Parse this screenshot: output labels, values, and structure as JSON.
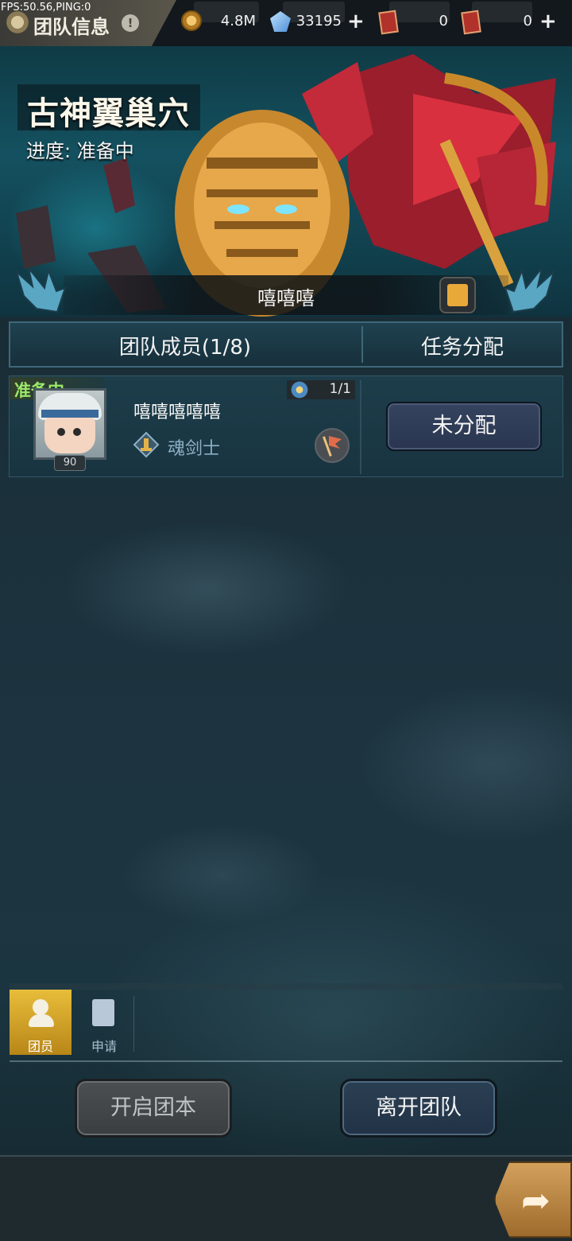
{
  "debug": {
    "fps_text": "FPS:50.56,PING:0"
  },
  "header": {
    "title": "团队信息",
    "info_glyph": "!",
    "currencies": [
      {
        "icon": "gold-coin-icon",
        "value": "4.8M",
        "has_plus": false
      },
      {
        "icon": "crystal-icon",
        "value": "33195",
        "has_plus": true
      },
      {
        "icon": "ticket-icon",
        "value": "0",
        "has_plus": false
      },
      {
        "icon": "ticket-icon",
        "value": "0",
        "has_plus": true
      }
    ],
    "plus_glyph": "+"
  },
  "banner": {
    "dungeon_name": "古神翼巢穴",
    "progress": "进度: 准备中",
    "team_name": "嘻嘻嘻"
  },
  "tabs": [
    {
      "label": "团队成员(1/8)"
    },
    {
      "label": "任务分配"
    }
  ],
  "members": [
    {
      "status": "准备中",
      "level": "90",
      "name": "嘻嘻嘻嘻嘻",
      "class_name": "魂剑士",
      "count": "1/1",
      "assign_label": "未分配"
    }
  ],
  "side_tabs": [
    {
      "label": "团员",
      "icon": "members-icon",
      "active": true
    },
    {
      "label": "申请",
      "icon": "application-icon",
      "active": false
    }
  ],
  "actions": {
    "start_label": "开启团本",
    "leave_label": "离开团队"
  },
  "colors": {
    "ready_green": "#9be86a",
    "accent_gold": "#e8bd3a",
    "class_blue": "#8cb0c6"
  }
}
